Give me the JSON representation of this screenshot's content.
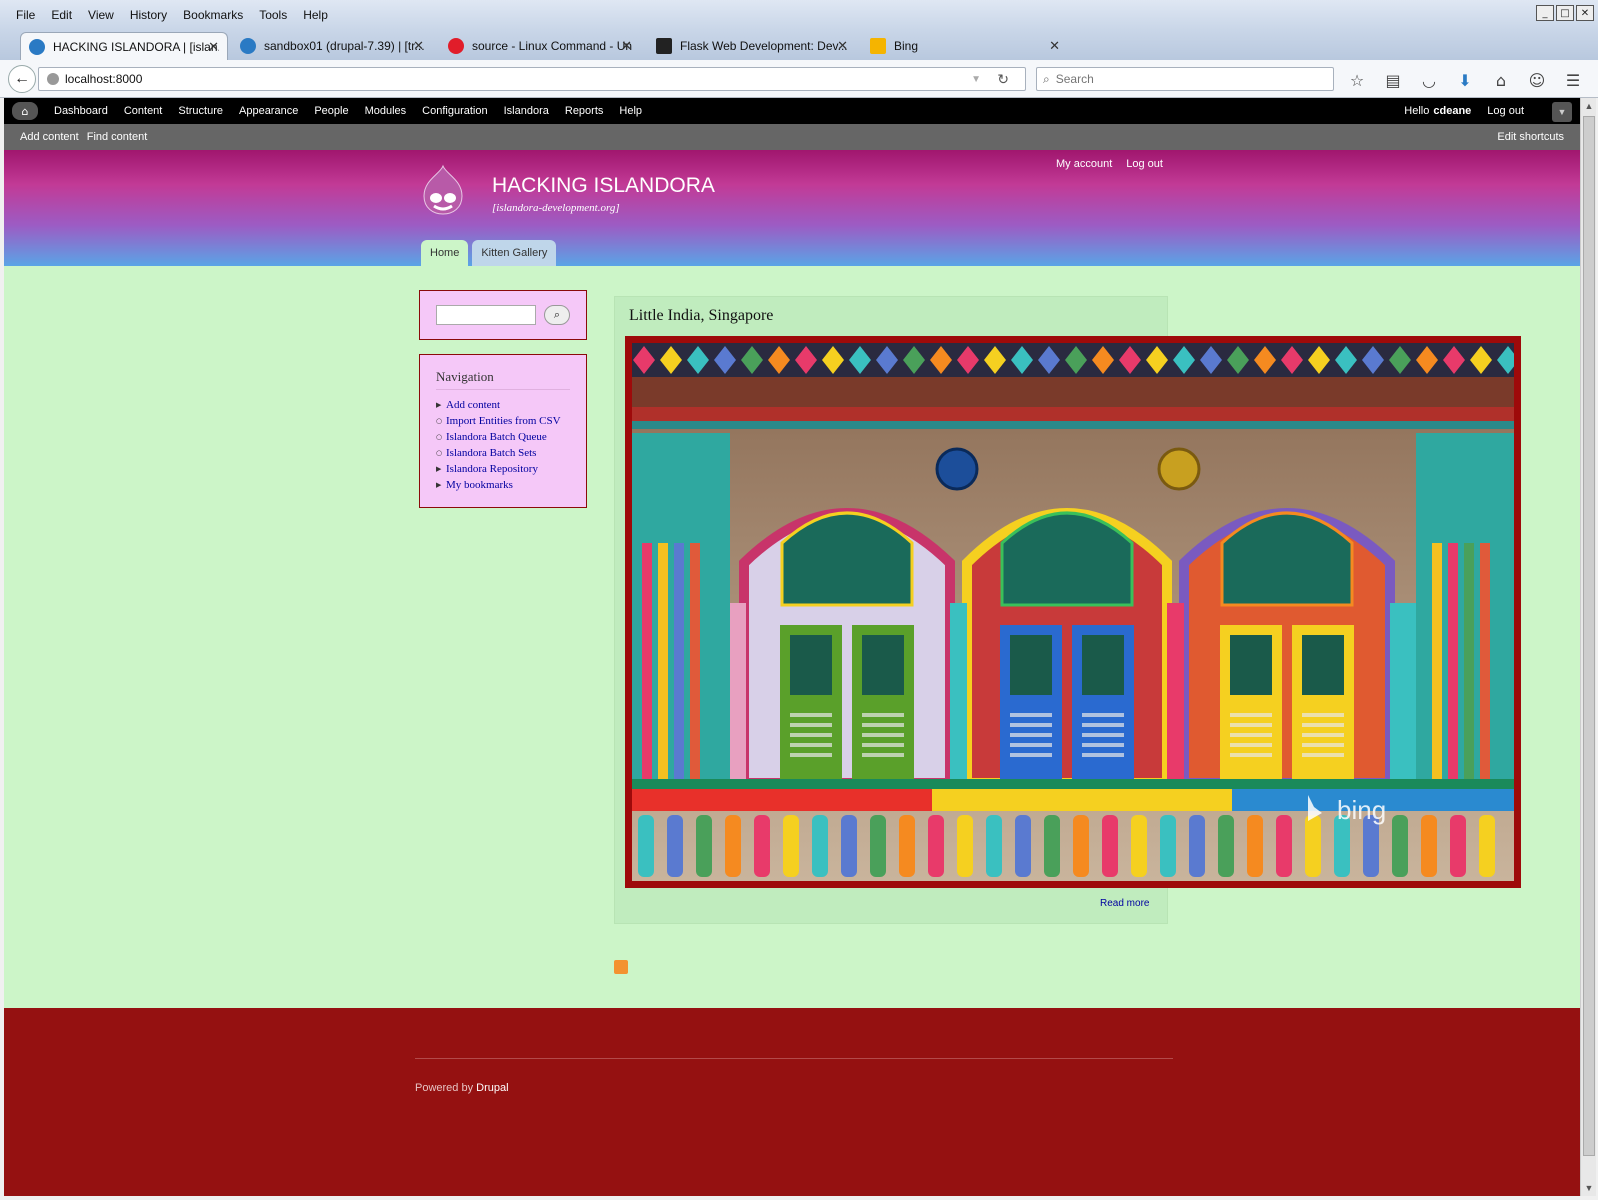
{
  "browser": {
    "menu": [
      "File",
      "Edit",
      "View",
      "History",
      "Bookmarks",
      "Tools",
      "Help"
    ],
    "tabs": [
      {
        "title": "HACKING ISLANDORA | [islan...",
        "active": true,
        "favicon_color": "#2a7ac4"
      },
      {
        "title": "sandbox01 (drupal-7.39) | [tr...",
        "active": false,
        "favicon_color": "#2a7ac4"
      },
      {
        "title": "source - Linux Command - Uni...",
        "active": false,
        "favicon_color": "#e11d2a"
      },
      {
        "title": "Flask Web Development: Dev...",
        "active": false,
        "favicon_color": "#222222"
      },
      {
        "title": "Bing",
        "active": false,
        "favicon_color": "#f5b400"
      }
    ],
    "url": "localhost:8000",
    "search_placeholder": "Search",
    "toolbar_icons": [
      "bookmark-star-icon",
      "reading-list-icon",
      "pocket-icon",
      "download-icon",
      "home-icon",
      "chat-icon",
      "hamburger-menu-icon"
    ]
  },
  "admin_toolbar": {
    "menu": [
      "Dashboard",
      "Content",
      "Structure",
      "Appearance",
      "People",
      "Modules",
      "Configuration",
      "Islandora",
      "Reports",
      "Help"
    ],
    "greeting": "Hello",
    "username": "cdeane",
    "logout": "Log out",
    "shortcuts": [
      "Add content",
      "Find content"
    ],
    "edit_shortcuts": "Edit shortcuts"
  },
  "site": {
    "name": "HACKING ISLANDORA",
    "slogan": "[islandora-development.org]",
    "secondary_menu": [
      "My account",
      "Log out"
    ],
    "primary_tabs": [
      {
        "label": "Home",
        "active": true
      },
      {
        "label": "Kitten Gallery",
        "active": false
      }
    ]
  },
  "sidebar": {
    "navigation_title": "Navigation",
    "navigation_items": [
      {
        "label": "Add content",
        "bullet": "▶"
      },
      {
        "label": "Import Entities from CSV",
        "bullet": "○"
      },
      {
        "label": "Islandora Batch Queue",
        "bullet": "○"
      },
      {
        "label": "Islandora Batch Sets",
        "bullet": "○"
      },
      {
        "label": "Islandora Repository",
        "bullet": "▶"
      },
      {
        "label": "My bookmarks",
        "bullet": "▶"
      }
    ]
  },
  "node": {
    "title": "Little India, Singapore",
    "watermark": "bing",
    "read_more": "Read more"
  },
  "footer": {
    "powered_by": "Powered by",
    "drupal": "Drupal"
  },
  "colors": {
    "page_bg": "#ccf5c8",
    "sidebar_block_bg": "#f5c8f8",
    "footer_bg": "#951111",
    "image_border": "#9e0a0a"
  }
}
